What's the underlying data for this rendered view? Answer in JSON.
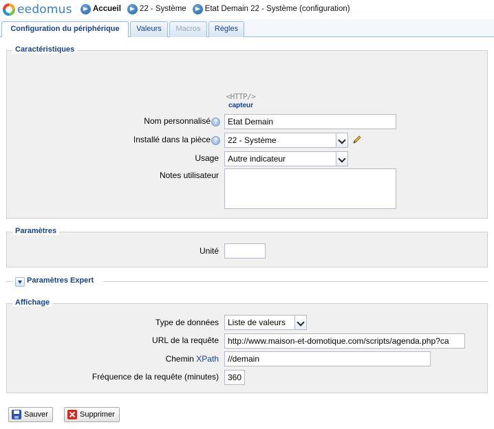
{
  "app": {
    "name": "eedomus"
  },
  "breadcrumb": {
    "items": [
      {
        "label": "Accueil",
        "bold": true
      },
      {
        "label": "22 - Système",
        "bold": false
      },
      {
        "label": "Etat Demain 22 - Système (configuration)",
        "bold": false
      }
    ]
  },
  "tabs": [
    {
      "label": "Configuration du périphérique",
      "state": "active"
    },
    {
      "label": "Valeurs",
      "state": "normal"
    },
    {
      "label": "Macros",
      "state": "disabled"
    },
    {
      "label": "Règles",
      "state": "normal"
    }
  ],
  "caracteristiques": {
    "legend": "Caractéristiques",
    "device_logo_word": "<HTTP/>",
    "device_logo_sub": "capteur",
    "nom_label": "Nom personnalisé",
    "nom_value": "Etat Demain",
    "piece_label": "Installé dans la pièce",
    "piece_value": "22 - Système",
    "usage_label": "Usage",
    "usage_value": "Autre indicateur",
    "notes_label": "Notes utilisateur",
    "notes_value": ""
  },
  "parametres": {
    "legend": "Paramètres",
    "unite_label": "Unité",
    "unite_value": ""
  },
  "expert": {
    "label": "Paramètres Expert"
  },
  "affichage": {
    "legend": "Affichage",
    "type_label": "Type de données",
    "type_value": "Liste de valeurs",
    "url_label": "URL de la requête",
    "url_value": "http://www.maison-et-domotique.com/scripts/agenda.php?ca",
    "chemin_label": "Chemin",
    "xpath_link": "XPath",
    "chemin_value": "//demain",
    "freq_label": "Fréquence de la requête (minutes)",
    "freq_value": "360"
  },
  "buttons": {
    "save_label": "Sauver",
    "delete_label": "Supprimer"
  },
  "colors": {
    "accent": "#15428b",
    "tab_border": "#99bbe8",
    "fieldset_bg": "#f0f0f0"
  },
  "icons": {
    "help": "help-icon",
    "edit": "pencil-icon",
    "save": "save-icon",
    "delete": "delete-icon",
    "nav": "arrow-right-circle-icon"
  }
}
